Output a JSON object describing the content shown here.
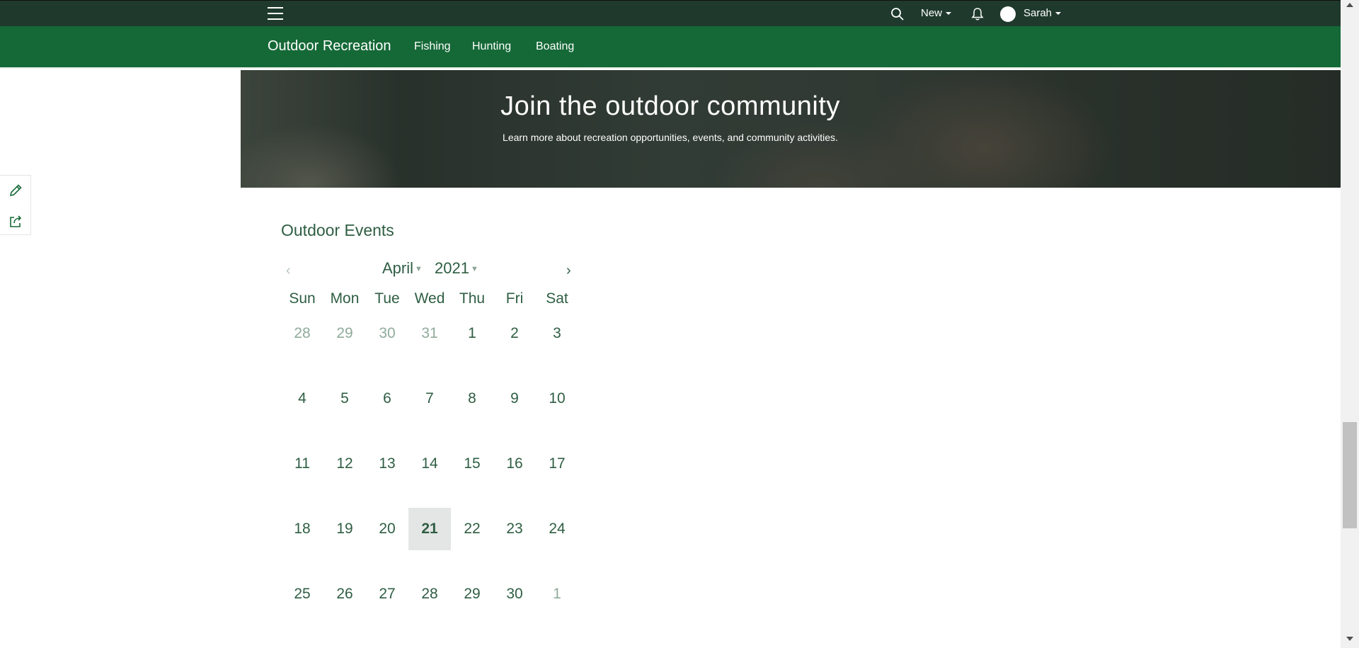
{
  "topbar": {
    "new_label": "New",
    "user_name": "Sarah",
    "icons": [
      "hamburger-menu-icon",
      "search-icon",
      "bell-icon",
      "avatar"
    ]
  },
  "nav": {
    "site_title": "Outdoor Recreation",
    "links": [
      "Fishing",
      "Hunting",
      "Boating"
    ]
  },
  "hero": {
    "title": "Join the outdoor community",
    "subtitle": "Learn more about recreation opportunities, events, and community activities."
  },
  "side_tools": [
    "pencil-icon",
    "share-icon"
  ],
  "events": {
    "title": "Outdoor Events",
    "calendar": {
      "prev_label": "‹",
      "next_label": "›",
      "month": "April",
      "year": "2021",
      "weekdays": [
        "Sun",
        "Mon",
        "Tue",
        "Wed",
        "Thu",
        "Fri",
        "Sat"
      ],
      "weeks": [
        [
          {
            "d": "28",
            "m": true
          },
          {
            "d": "29",
            "m": true
          },
          {
            "d": "30",
            "m": true
          },
          {
            "d": "31",
            "m": true
          },
          {
            "d": "1"
          },
          {
            "d": "2"
          },
          {
            "d": "3"
          }
        ],
        [
          {
            "d": "4"
          },
          {
            "d": "5"
          },
          {
            "d": "6"
          },
          {
            "d": "7"
          },
          {
            "d": "8"
          },
          {
            "d": "9"
          },
          {
            "d": "10"
          }
        ],
        [
          {
            "d": "11"
          },
          {
            "d": "12"
          },
          {
            "d": "13"
          },
          {
            "d": "14"
          },
          {
            "d": "15"
          },
          {
            "d": "16"
          },
          {
            "d": "17"
          }
        ],
        [
          {
            "d": "18"
          },
          {
            "d": "19"
          },
          {
            "d": "20"
          },
          {
            "d": "21",
            "today": true
          },
          {
            "d": "22"
          },
          {
            "d": "23"
          },
          {
            "d": "24"
          }
        ],
        [
          {
            "d": "25"
          },
          {
            "d": "26"
          },
          {
            "d": "27"
          },
          {
            "d": "28"
          },
          {
            "d": "29"
          },
          {
            "d": "30"
          },
          {
            "d": "1",
            "m": true
          }
        ]
      ]
    }
  },
  "colors": {
    "topbar": "#1f3a2c",
    "navbar": "#156937",
    "text_green": "#2f5e43",
    "muted_day": "#8fab9b",
    "today_bg": "#e4e6e5"
  }
}
